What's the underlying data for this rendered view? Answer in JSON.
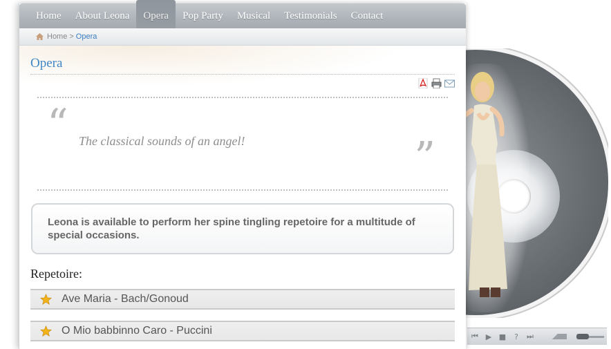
{
  "nav": {
    "items": [
      "Home",
      "About Leona",
      "Opera",
      "Pop Party",
      "Musical",
      "Testimonials",
      "Contact"
    ],
    "active_index": 2
  },
  "breadcrumb": {
    "home": "Home",
    "separator": ">",
    "current": "Opera"
  },
  "page": {
    "title": "Opera",
    "quote": "The classical sounds of an angel!",
    "info": "Leona is available to perform her spine tingling repetoire for a multitude of special occasions.",
    "repertoire_heading": "Repetoire:",
    "repertoire": [
      "Ave Maria - Bach/Gonoud",
      "O Mio babbinno Caro - Puccini"
    ]
  },
  "tools": [
    "pdf-icon",
    "print-icon",
    "email-icon"
  ],
  "colors": {
    "title": "#3f86c6",
    "nav_bg": "#aeb4ba",
    "breadcrumb_current": "#3a7cc2",
    "star": "#f2b21a"
  }
}
